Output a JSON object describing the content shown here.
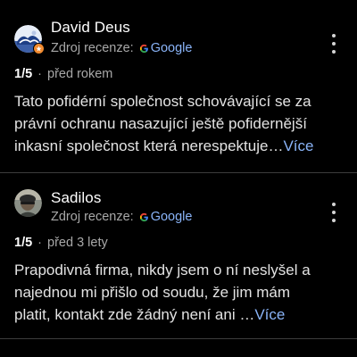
{
  "reviews": [
    {
      "author": "David Deus",
      "source_label": "Zdroj recenze:",
      "source_name": "Google",
      "rating": "1/5",
      "separator": "·",
      "time": "před rokem",
      "text_lines": [
        "Tato pofidérní společnost schovávající se za",
        "právní ochranu nasazující ještě pofidernější",
        "inkasní společnost která nerespektuje…"
      ],
      "more_label": "Více"
    },
    {
      "author": "Sadilos",
      "source_label": "Zdroj recenze:",
      "source_name": "Google",
      "rating": "1/5",
      "separator": "·",
      "time": "před 3 lety",
      "text_lines": [
        "Prapodivná firma, nikdy jsem o ní neslyšel a",
        "najednou mi přišlo od soudu, že jim mám",
        "platit, kontakt zde žádný není ani …"
      ],
      "more_label": "Více"
    }
  ],
  "colors": {
    "background": "#000000",
    "link": "#8ab4f8",
    "divider": "#3c3c3c",
    "badge": "#f28b30"
  },
  "icons": {
    "more": "more-vert-icon",
    "google": "google-g-icon",
    "badge": "local-guide-badge-icon"
  }
}
